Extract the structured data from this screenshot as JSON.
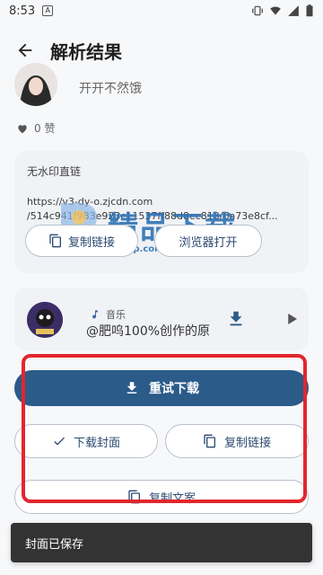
{
  "status": {
    "time": "8:53",
    "notif_letter": "A"
  },
  "header": {
    "title": "解析结果"
  },
  "user": {
    "name": "开开不然饿"
  },
  "likes": {
    "text": "0 赞"
  },
  "link_card": {
    "title": "无水印直链",
    "url_line1": "https://v3-dy-o.zjcdn.com",
    "url_line2": "/514c941f983e923c11537ff88d8ec813/6a73e8cf...",
    "copy_label": "复制链接",
    "browser_label": "浏览器打开"
  },
  "watermark": {
    "text": "精品下载",
    "sub": "j9p.com"
  },
  "music": {
    "label": "音乐",
    "title": "@肥呜100%创作的原"
  },
  "actions": {
    "retry_label": "重试下载",
    "cover_label": "下载封面",
    "copy_link_label": "复制链接",
    "copy_text_label": "复制文案"
  },
  "snackbar": {
    "text": "封面已保存"
  },
  "colors": {
    "primary": "#2a5b89",
    "highlight": "#e3262e",
    "accent": "#2f73b5"
  }
}
